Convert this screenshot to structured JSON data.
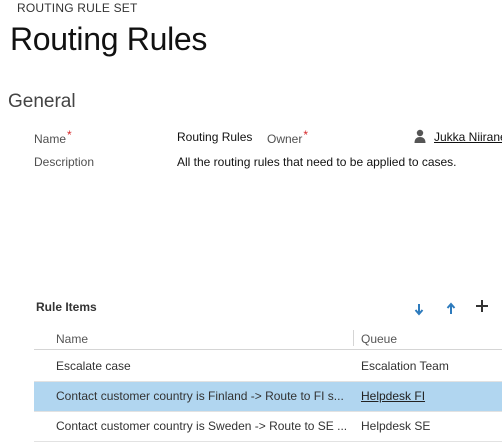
{
  "header": {
    "entity_type": "ROUTING RULE SET",
    "title": "Routing Rules"
  },
  "general": {
    "section_title": "General",
    "name_label": "Name",
    "required_mark": "*",
    "name_value": "Routing Rules",
    "owner_label": "Owner",
    "owner_value": "Jukka Niiranen",
    "description_label": "Description",
    "description_value": "All the routing rules that need to be applied to cases."
  },
  "rule_items": {
    "title": "Rule Items",
    "columns": {
      "name": "Name",
      "queue": "Queue"
    },
    "rows": [
      {
        "name": "Escalate case",
        "queue": "Escalation Team",
        "selected": false,
        "queue_link": false
      },
      {
        "name": "Contact customer country is Finland -> Route to FI s...",
        "queue": "Helpdesk FI",
        "selected": true,
        "queue_link": true
      },
      {
        "name": "Contact customer country is Sweden -> Route to SE ...",
        "queue": "Helpdesk SE",
        "selected": false,
        "queue_link": false
      }
    ]
  },
  "icons": {
    "move_down": "arrow-down-icon",
    "move_up": "arrow-up-icon",
    "add": "plus-icon",
    "owner": "person-icon"
  },
  "colors": {
    "selected_row": "#b1d6f0",
    "required": "#d6292b",
    "arrow_blue": "#2e7bbd"
  }
}
